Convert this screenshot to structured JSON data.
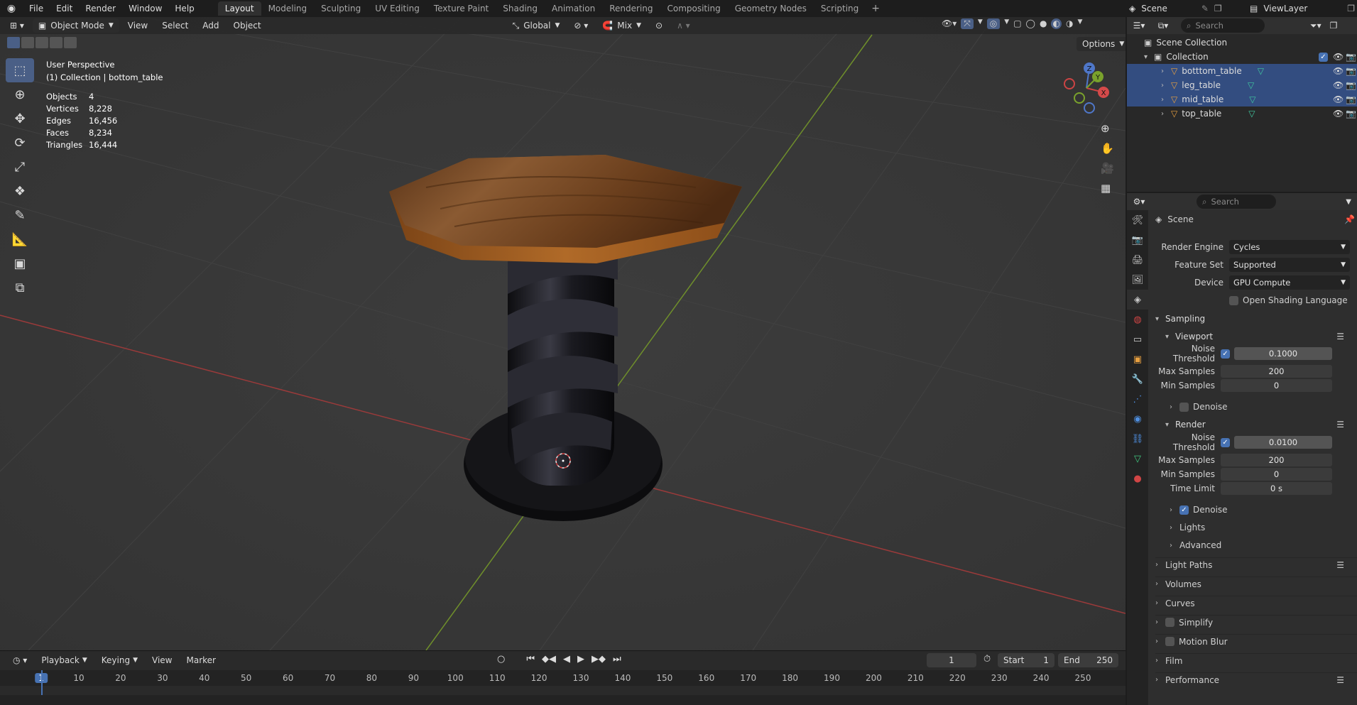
{
  "topbar": {
    "menus": [
      "File",
      "Edit",
      "Render",
      "Window",
      "Help"
    ],
    "workspaces": [
      "Layout",
      "Modeling",
      "Sculpting",
      "UV Editing",
      "Texture Paint",
      "Shading",
      "Animation",
      "Rendering",
      "Compositing",
      "Geometry Nodes",
      "Scripting"
    ],
    "active_workspace": "Layout",
    "scene": "Scene",
    "view_layer": "ViewLayer"
  },
  "viewport_header": {
    "mode": "Object Mode",
    "menus": [
      "View",
      "Select",
      "Add",
      "Object"
    ],
    "transform_orientation": "Global",
    "snap_mode": "Mix",
    "options": "Options"
  },
  "overlay": {
    "view_name": "User Perspective",
    "collection_line": "(1) Collection | bottom_table",
    "stats": [
      {
        "label": "Objects",
        "value": "4"
      },
      {
        "label": "Vertices",
        "value": "8,228"
      },
      {
        "label": "Edges",
        "value": "16,456"
      },
      {
        "label": "Faces",
        "value": "8,234"
      },
      {
        "label": "Triangles",
        "value": "16,444"
      }
    ]
  },
  "gizmo": {
    "x": "X",
    "y": "Y",
    "z": "Z"
  },
  "timeline": {
    "menus": [
      "Playback",
      "Keying",
      "View",
      "Marker"
    ],
    "current_frame": "1",
    "start_label": "Start",
    "start": "1",
    "end_label": "End",
    "end": "250",
    "ticks": [
      "1",
      "10",
      "20",
      "30",
      "40",
      "50",
      "60",
      "70",
      "80",
      "90",
      "100",
      "110",
      "120",
      "130",
      "140",
      "150",
      "160",
      "170",
      "180",
      "190",
      "200",
      "210",
      "220",
      "230",
      "240",
      "250"
    ]
  },
  "outliner": {
    "search_placeholder": "Search",
    "scene_collection": "Scene Collection",
    "collection": "Collection",
    "objects": [
      {
        "name": "botttom_table",
        "selected": true
      },
      {
        "name": "leg_table",
        "selected": true
      },
      {
        "name": "mid_table",
        "selected": true
      },
      {
        "name": "top_table",
        "selected": false
      }
    ]
  },
  "properties": {
    "search_placeholder": "Search",
    "context": "Scene",
    "render_engine_label": "Render Engine",
    "render_engine": "Cycles",
    "feature_set_label": "Feature Set",
    "feature_set": "Supported",
    "device_label": "Device",
    "device": "GPU Compute",
    "osl_label": "Open Shading Language",
    "sampling": {
      "title": "Sampling",
      "viewport": {
        "title": "Viewport",
        "noise_threshold_label": "Noise Threshold",
        "noise_threshold": "0.1000",
        "max_samples_label": "Max Samples",
        "max_samples": "200",
        "min_samples_label": "Min Samples",
        "min_samples": "0",
        "denoise_label": "Denoise"
      },
      "render": {
        "title": "Render",
        "noise_threshold_label": "Noise Threshold",
        "noise_threshold": "0.0100",
        "max_samples_label": "Max Samples",
        "max_samples": "200",
        "min_samples_label": "Min Samples",
        "min_samples": "0",
        "time_limit_label": "Time Limit",
        "time_limit": "0 s",
        "denoise_label": "Denoise"
      },
      "lights": "Lights",
      "advanced": "Advanced"
    },
    "panels": [
      "Light Paths",
      "Volumes",
      "Curves",
      "Simplify",
      "Motion Blur",
      "Film",
      "Performance"
    ]
  }
}
